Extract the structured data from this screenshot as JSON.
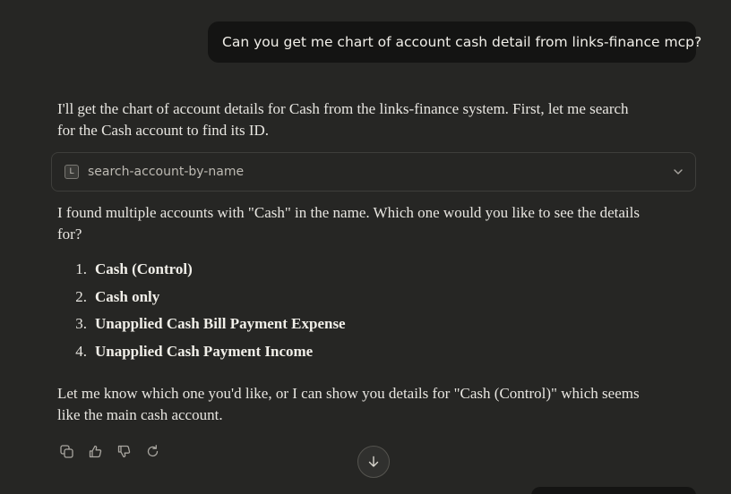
{
  "user_message": "Can you get me chart of account cash detail from links-finance mcp?",
  "assistant": {
    "intro": "I'll get the chart of account details for Cash from the links-finance system. First, let me search for the Cash account to find its ID.",
    "tool": {
      "logo_letter": "L",
      "name": "search-account-by-name",
      "toggle_icon": "chevron-down-icon"
    },
    "found_text": "I found multiple accounts with \"Cash\" in the name. Which one would you like to see the details for?",
    "accounts": [
      {
        "number": "1.",
        "label": "Cash (Control)"
      },
      {
        "number": "2.",
        "label": "Cash only"
      },
      {
        "number": "3.",
        "label": "Unapplied Cash Bill Payment Expense"
      },
      {
        "number": "4.",
        "label": "Unapplied Cash Payment Income"
      }
    ],
    "closing_text": "Let me know which one you'd like, or I can show you details for \"Cash (Control)\" which seems like the main cash account."
  },
  "message_actions": [
    "copy-icon",
    "thumbs-up-icon",
    "thumbs-down-icon",
    "retry-icon"
  ],
  "scroll_button_icon": "arrow-down-icon"
}
